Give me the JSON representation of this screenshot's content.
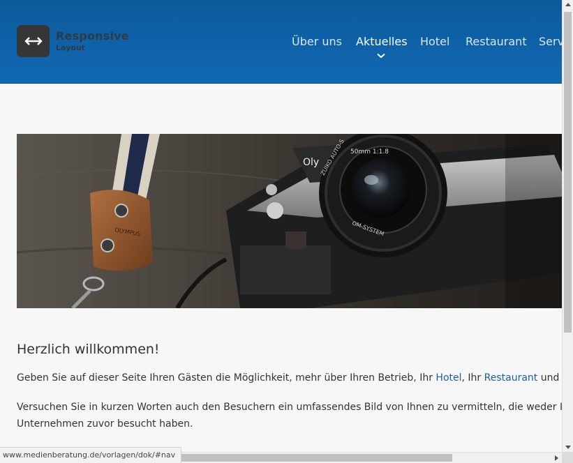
{
  "logo": {
    "title": "Responsive",
    "subtitle": "Layout",
    "icon": "double-arrow-icon"
  },
  "nav": {
    "items": [
      {
        "label": "Über uns"
      },
      {
        "label": "Aktuelles",
        "active": true
      },
      {
        "label": "Hotel"
      },
      {
        "label": "Restaurant"
      },
      {
        "label": "Serv"
      }
    ]
  },
  "hero": {
    "description_icon": "camera-photo"
  },
  "content": {
    "heading": "Herzlich willkommen!",
    "p1_pre": "Geben Sie auf dieser Seite Ihren Gästen die Möglichkeit, mehr über Ihren Betrieb, Ihr ",
    "p1_link_hotel": "Hotel",
    "p1_mid": ", Ihr ",
    "p1_link_restaurant": "Restaurant",
    "p1_post": " und Ihren",
    "p2_line1": "Versuchen Sie in kurzen Worten auch den Besuchern ein umfassendes Bild von Ihnen zu vermitteln, die weder Ihre W",
    "p2_line2": "Unternehmen zuvor besucht haben."
  },
  "statusbar": {
    "url": "www.medienberatung.de/vorlagen/dok/#nav"
  },
  "colors": {
    "header": "#0f63aa",
    "link": "#1c5f9e",
    "logo_box": "#363636"
  }
}
